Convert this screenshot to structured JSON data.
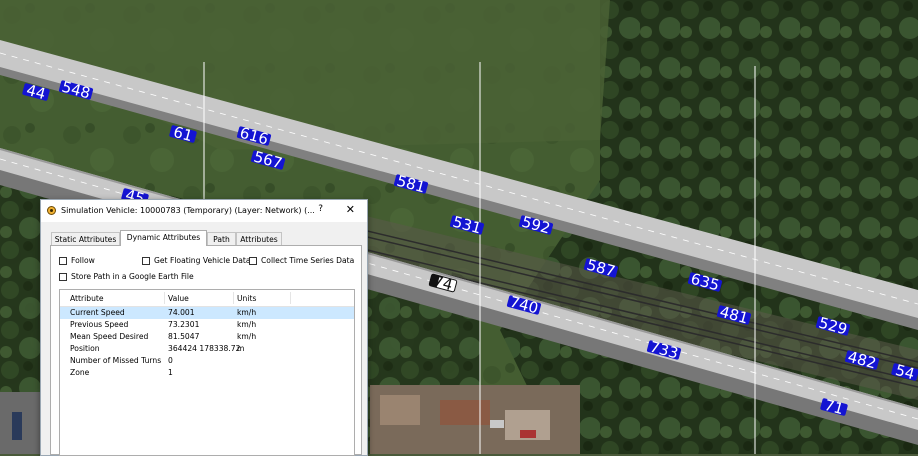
{
  "dialog": {
    "title": "Simulation Vehicle: 10000783 (Temporary) (Layer: Network) (...",
    "help": "?",
    "close": "✕",
    "tabs": [
      "Static Attributes",
      "Dynamic Attributes",
      "Path",
      "Attributes"
    ],
    "active_tab": 1,
    "checkboxes": {
      "follow": "Follow",
      "floating": "Get Floating Vehicle Data",
      "timeseries": "Collect Time Series Data",
      "google_earth": "Store Path in a Google Earth File"
    },
    "grid": {
      "columns": [
        "Attribute",
        "Value",
        "Units"
      ],
      "rows": [
        {
          "attribute": "Current Speed",
          "value": "74.001",
          "units": "km/h",
          "selected": true
        },
        {
          "attribute": "Previous Speed",
          "value": "73.2301",
          "units": "km/h"
        },
        {
          "attribute": "Mean Speed Desired",
          "value": "81.5047",
          "units": "km/h"
        },
        {
          "attribute": "Position",
          "value": "364424 178338.72",
          "units": "m"
        },
        {
          "attribute": "Number of Missed Turns",
          "value": "0",
          "units": ""
        },
        {
          "attribute": "Zone",
          "value": "1",
          "units": ""
        }
      ]
    }
  },
  "vehicles": [
    {
      "label": "44",
      "color": "blue"
    },
    {
      "label": "548",
      "color": "blue"
    },
    {
      "label": "61",
      "color": "blue"
    },
    {
      "label": "616",
      "color": "blue"
    },
    {
      "label": "567",
      "color": "blue"
    },
    {
      "label": "581",
      "color": "blue"
    },
    {
      "label": "45",
      "color": "blue"
    },
    {
      "label": "531",
      "color": "blue"
    },
    {
      "label": "592",
      "color": "blue"
    },
    {
      "label": "587",
      "color": "blue"
    },
    {
      "label": "74",
      "color": "black"
    },
    {
      "label": "635",
      "color": "blue"
    },
    {
      "label": "740",
      "color": "blue"
    },
    {
      "label": "481",
      "color": "blue"
    },
    {
      "label": "529",
      "color": "blue"
    },
    {
      "label": "733",
      "color": "blue"
    },
    {
      "label": "482",
      "color": "blue"
    },
    {
      "label": "54",
      "color": "blue"
    },
    {
      "label": "71",
      "color": "blue"
    }
  ],
  "colors": {
    "road": "#c8c8c8",
    "vehicle": "#1414d2",
    "selected_row": "#cce8ff",
    "grass": "#3f5a2c"
  }
}
